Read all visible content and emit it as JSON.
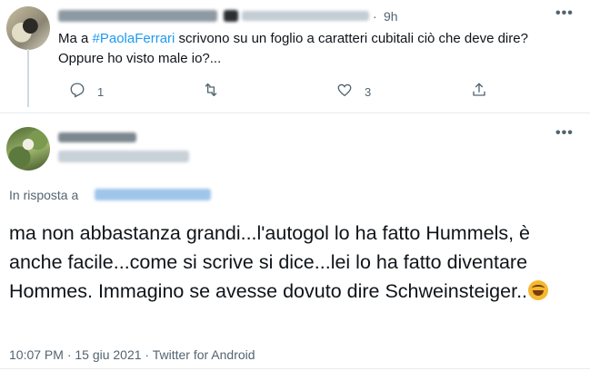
{
  "tweet_parent": {
    "time": "9h",
    "text_before": "Ma a ",
    "hashtag": "#PaolaFerrari",
    "text_after": " scrivono su un foglio a caratteri cubitali ciò che deve dire? Oppure ho visto male io?...",
    "reply_count": "1",
    "like_count": "3",
    "dot": "·",
    "more": "•••"
  },
  "tweet_main": {
    "replying_to_label": "In risposta a",
    "text": "ma non abbastanza grandi...l'autogol lo ha fatto Hummels,  è  anche facile...come si scrive si dice...lei lo ha fatto diventare Hommes. Immagino se avesse dovuto dire Schweinsteiger..",
    "emoji": "rolling-on-floor-laughing",
    "meta": "10:07 PM · 15 giu 2021 · Twitter for Android",
    "more": "•••"
  },
  "icons": {
    "reply": "reply-icon",
    "retweet": "retweet-icon",
    "like": "like-icon",
    "share": "share-icon"
  },
  "colors": {
    "text": "#0f1419",
    "secondary": "#536471",
    "accent": "#1d9bf0",
    "divider": "#e6ecf0"
  }
}
